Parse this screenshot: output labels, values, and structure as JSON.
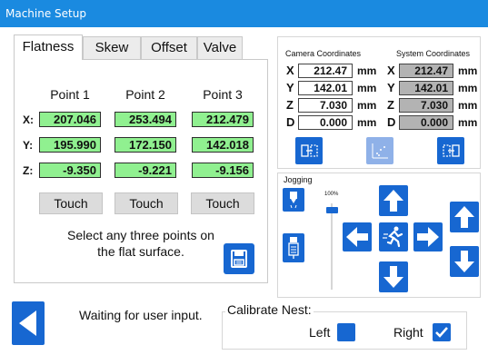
{
  "window": {
    "title": "Machine Setup"
  },
  "tabs": [
    {
      "label": "Flatness",
      "active": true
    },
    {
      "label": "Skew",
      "active": false
    },
    {
      "label": "Offset",
      "active": false
    },
    {
      "label": "Valve",
      "active": false
    }
  ],
  "flatness": {
    "columns": [
      "Point 1",
      "Point 2",
      "Point 3"
    ],
    "rows": [
      {
        "label": "X:",
        "values": [
          "207.046",
          "253.494",
          "212.479"
        ]
      },
      {
        "label": "Y:",
        "values": [
          "195.990",
          "172.150",
          "142.018"
        ]
      },
      {
        "label": "Z:",
        "values": [
          "-9.350",
          "-9.221",
          "-9.156"
        ]
      }
    ],
    "touch_label": "Touch",
    "instruction_line1": "Select any three points on",
    "instruction_line2": "the flat surface."
  },
  "coordinates": {
    "camera_header": "Camera Coordinates",
    "system_header": "System Coordinates",
    "unit": "mm",
    "camera": [
      {
        "axis": "X",
        "value": "212.47"
      },
      {
        "axis": "Y",
        "value": "142.01"
      },
      {
        "axis": "Z",
        "value": "7.030"
      },
      {
        "axis": "D",
        "value": "0.000"
      }
    ],
    "system": [
      {
        "axis": "X",
        "value": "212.47"
      },
      {
        "axis": "Y",
        "value": "142.01"
      },
      {
        "axis": "Z",
        "value": "7.030"
      },
      {
        "axis": "D",
        "value": "0.000"
      }
    ]
  },
  "jogging": {
    "title": "Jogging",
    "speed_label": "100%",
    "speed_fraction": 1.0
  },
  "status": {
    "text": "Waiting for user input."
  },
  "calibrate_nest": {
    "title": "Calibrate Nest:",
    "left_label": "Left",
    "right_label": "Right",
    "left_checked": false,
    "right_checked": true
  },
  "colors": {
    "accent": "#1767d1",
    "titlebar": "#1a8ae0",
    "value_green": "#90f090"
  }
}
